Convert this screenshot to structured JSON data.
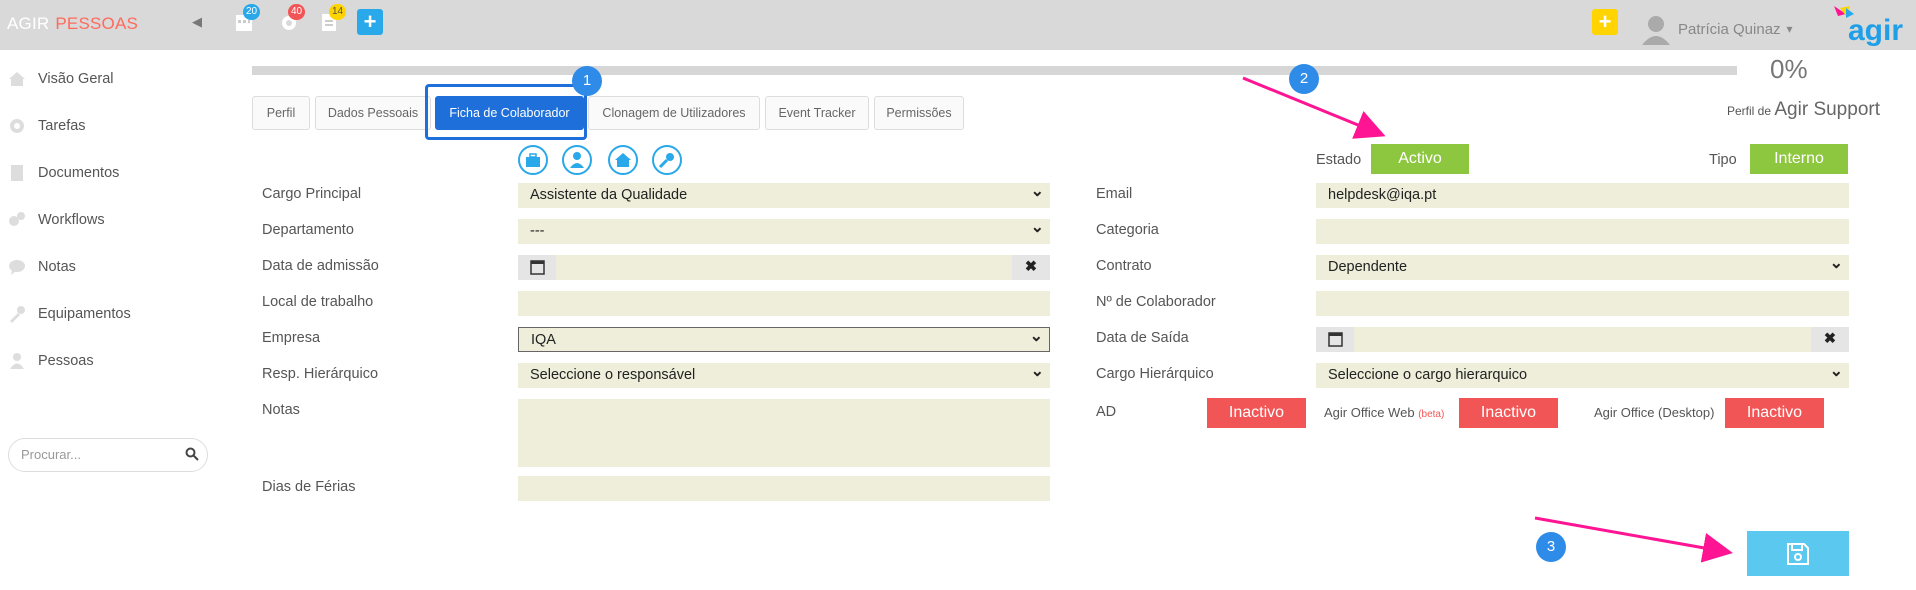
{
  "header": {
    "brand_agir": "AGIR",
    "brand_module": "PESSOAS",
    "badges": {
      "calendar": "20",
      "settings": "40",
      "docs": "14"
    },
    "user_name": "Patrícia Quinaz",
    "logo_text": "agir",
    "colors": {
      "topbar": "#d9d9d9",
      "accent_red": "#ff6a5c",
      "yellow": "#ffd400",
      "blue": "#29a8ea"
    }
  },
  "sidebar": {
    "items": [
      {
        "label": "Visão Geral",
        "icon": "home-icon"
      },
      {
        "label": "Tarefas",
        "icon": "gear-icon"
      },
      {
        "label": "Documentos",
        "icon": "document-icon"
      },
      {
        "label": "Workflows",
        "icon": "workflow-icon"
      },
      {
        "label": "Notas",
        "icon": "chat-icon"
      },
      {
        "label": "Equipamentos",
        "icon": "wrench-icon"
      },
      {
        "label": "Pessoas",
        "icon": "person-icon"
      }
    ],
    "search_placeholder": "Procurar..."
  },
  "progress": {
    "value": 0,
    "label": "0%"
  },
  "profile": {
    "prefix": "Perfil de",
    "name": "Agir Support"
  },
  "tabs": [
    {
      "label": "Perfil"
    },
    {
      "label": "Dados Pessoais"
    },
    {
      "label": "Ficha de Colaborador",
      "active": true
    },
    {
      "label": "Clonagem de Utilizadores"
    },
    {
      "label": "Event Tracker"
    },
    {
      "label": "Permissões"
    }
  ],
  "annotations": [
    "1",
    "2",
    "3"
  ],
  "section_icons": [
    "briefcase-icon",
    "user-tie-icon",
    "house-icon",
    "key-icon"
  ],
  "status": {
    "estado_label": "Estado",
    "estado_value": "Activo",
    "tipo_label": "Tipo",
    "tipo_value": "Interno"
  },
  "left_form": {
    "cargo_principal": {
      "label": "Cargo Principal",
      "value": "Assistente da Qualidade"
    },
    "departamento": {
      "label": "Departamento",
      "value": "---"
    },
    "data_admissao": {
      "label": "Data de admissão",
      "value": ""
    },
    "local_trabalho": {
      "label": "Local de trabalho",
      "value": ""
    },
    "empresa": {
      "label": "Empresa",
      "value": "IQA"
    },
    "resp_hierarquico": {
      "label": "Resp. Hierárquico",
      "value": "Seleccione o responsável"
    },
    "notas": {
      "label": "Notas",
      "value": ""
    },
    "dias_ferias": {
      "label": "Dias de Férias",
      "value": ""
    }
  },
  "right_form": {
    "email": {
      "label": "Email",
      "value": "helpdesk@iqa.pt"
    },
    "categoria": {
      "label": "Categoria",
      "value": ""
    },
    "contrato": {
      "label": "Contrato",
      "value": "Dependente"
    },
    "n_colaborador": {
      "label": "Nº de Colaborador",
      "value": ""
    },
    "data_saida": {
      "label": "Data de Saída",
      "value": ""
    },
    "cargo_hierarquico": {
      "label": "Cargo Hierárquico",
      "value": "Seleccione o cargo hierarquico"
    }
  },
  "integrations": {
    "ad_label": "AD",
    "ad_value": "Inactivo",
    "office_web_label": "Agir Office Web",
    "office_web_beta": "(beta)",
    "office_web_value": "Inactivo",
    "office_desktop_label": "Agir Office (Desktop)",
    "office_desktop_value": "Inactivo"
  },
  "colors": {
    "active_green": "#8dc63f",
    "inactive_red": "#f25555",
    "tab_blue": "#1e6fd9",
    "field_bg": "#eeeeda",
    "save_bg": "#5bc8f0",
    "annotation_pink": "#ff1493"
  }
}
